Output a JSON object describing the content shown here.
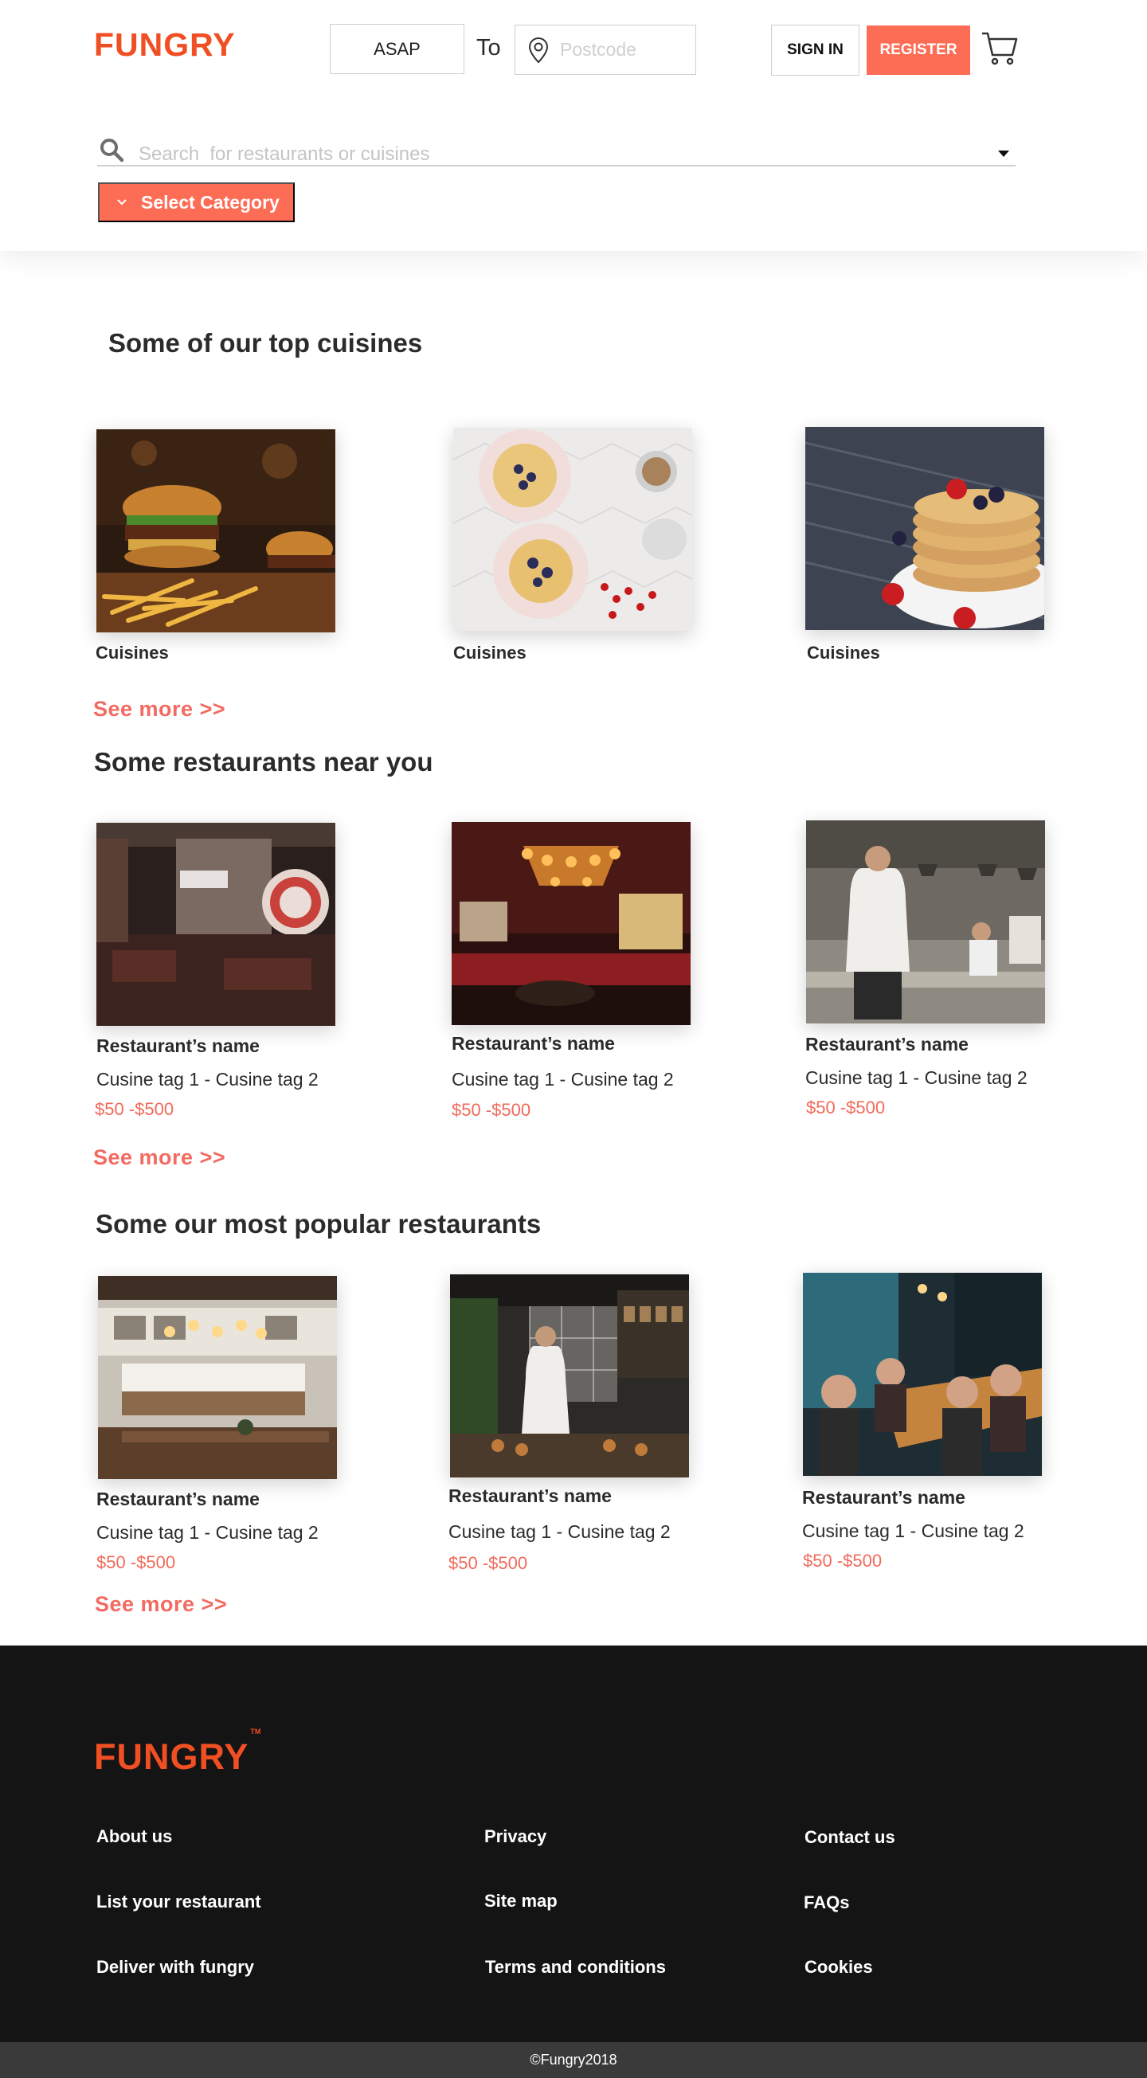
{
  "brand": {
    "logo_text": "FUNGRY",
    "accent_color": "#fd6c55",
    "logo_color": "#f04e23"
  },
  "header": {
    "asap_label": "ASAP",
    "to_label": "To",
    "postcode_placeholder": "Postcode",
    "signin_label": "SIGN IN",
    "register_label": "REGISTER",
    "cart_icon": "cart-icon"
  },
  "search": {
    "placeholder": "Search  for restaurants or cuisines",
    "category_label": "Select Category"
  },
  "cuisines": {
    "title": "Some of our top cuisines",
    "items": [
      {
        "label": "Cuisines",
        "image": "burger-fries-photo"
      },
      {
        "label": "Cuisines",
        "image": "breakfast-plates-photo"
      },
      {
        "label": "Cuisines",
        "image": "pancakes-berries-photo"
      }
    ],
    "see_more": "See more  >>"
  },
  "nearby": {
    "title": "Some restaurants near  you",
    "items": [
      {
        "name": "Restaurant’s  name",
        "tags": "Cusine tag 1 - Cusine tag 2",
        "price": "$50 -$500",
        "image": "restaurant-storefront-photo"
      },
      {
        "name": "Restaurant’s  name",
        "tags": "Cusine tag 1 - Cusine tag 2",
        "price": "$50 -$500",
        "image": "chandelier-dining-room-photo"
      },
      {
        "name": "Restaurant’s  name",
        "tags": "Cusine tag 1 - Cusine tag 2",
        "price": "$50 -$500",
        "image": "chef-kitchen-photo"
      }
    ],
    "see_more": "See more  >>"
  },
  "popular": {
    "title": "Some our most popular restaurants",
    "items": [
      {
        "name": "Restaurant’s  name",
        "tags": "Cusine tag 1 - Cusine tag 2",
        "price": "$50 -$500",
        "image": "cafe-interior-photo"
      },
      {
        "name": "Restaurant’s  name",
        "tags": "Cusine tag 1 - Cusine tag 2",
        "price": "$50 -$500",
        "image": "open-kitchen-photo"
      },
      {
        "name": "Restaurant’s  name",
        "tags": "Cusine tag 1 - Cusine tag 2",
        "price": "$50 -$500",
        "image": "diners-table-photo"
      }
    ],
    "see_more": "See more >>"
  },
  "footer": {
    "logo_text": "FUNGRY",
    "trademark": "TM",
    "columns": [
      [
        "About us",
        "List your restaurant",
        "Deliver with fungry"
      ],
      [
        "Privacy",
        "Site map",
        "Terms and conditions"
      ],
      [
        "Contact us",
        "FAQs",
        "Cookies"
      ]
    ],
    "copyright": "©Fungry2018"
  }
}
